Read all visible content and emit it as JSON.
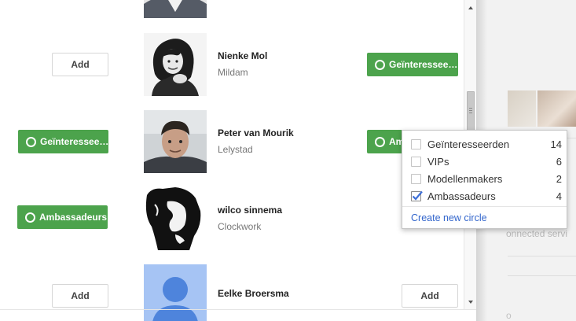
{
  "people": [
    {
      "name": "",
      "location": "",
      "left_action": "",
      "right_action": ""
    },
    {
      "name": "Nienke Mol",
      "location": "Mildam",
      "left_action": "Add",
      "right_action": "Geïnteressee…"
    },
    {
      "name": "Peter van Mourik",
      "location": "Lelystad",
      "left_action": "Geïnteressee…",
      "right_action": "Am"
    },
    {
      "name": "wilco sinnema",
      "location": "Clockwork",
      "left_action": "Ambassadeurs",
      "right_action": ""
    },
    {
      "name": "Eelke Broersma",
      "location": "",
      "left_action": "Add",
      "right_action": "Add"
    }
  ],
  "circle_dropdown": {
    "circles": [
      {
        "label": "Geïnteresseerden",
        "count": "14",
        "checked": false
      },
      {
        "label": "VIPs",
        "count": "6",
        "checked": false
      },
      {
        "label": "Modellenmakers",
        "count": "2",
        "checked": false
      },
      {
        "label": "Ambassadeurs",
        "count": "4",
        "checked": true
      }
    ],
    "create_label": "Create new circle"
  },
  "background": {
    "fragment_text": "onnected servi",
    "fragment_text2": "o"
  },
  "colors": {
    "accent_green": "#4ca34c",
    "link_blue": "#3366cc"
  }
}
